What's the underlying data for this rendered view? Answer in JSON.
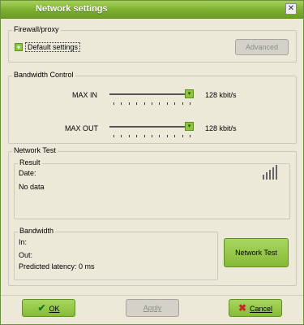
{
  "window": {
    "title": "Network settings",
    "close_label": "✕"
  },
  "firewall": {
    "group_label": "Firewall/proxy",
    "expand_symbol": "+",
    "default_label": "Default settings",
    "advanced_button": "Advanced"
  },
  "bandwidth_control": {
    "group_label": "Bandwidth Control",
    "max_in_label": "MAX IN",
    "max_in_value": "128 kbit/s",
    "max_out_label": "MAX OUT",
    "max_out_value": "128 kbit/s",
    "max_in_level": 1.0,
    "max_out_level": 1.0
  },
  "network_test": {
    "group_label": "Network Test",
    "result": {
      "label": "Result",
      "date_label": "Date:",
      "status": "No data"
    },
    "bandwidth": {
      "label": "Bandwidth",
      "in_label": "In:",
      "out_label": "Out:",
      "latency_label": "Predicted latency: 0 ms"
    },
    "test_button": "Network Test"
  },
  "footer": {
    "ok_label": "OK",
    "apply_label": "Apply",
    "cancel_label": "Cancel"
  },
  "icons": {
    "ok": "checkmark-icon",
    "cancel": "x-icon",
    "signal": "signal-strength-icon"
  },
  "colors": {
    "accent_green": "#8fc43d",
    "titlebar": "#7cae2f",
    "cancel_x": "#c62828",
    "ok_check": "#1e7a1e"
  }
}
